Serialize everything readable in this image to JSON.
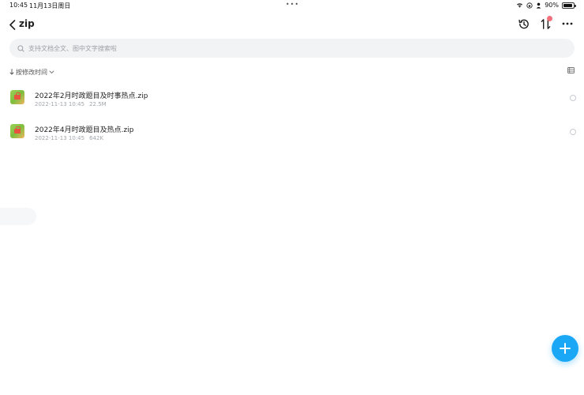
{
  "status_bar": {
    "time": "10:45",
    "date": "11月13日周日",
    "battery": "90%",
    "battery_level": 0.9
  },
  "nav": {
    "title": "zip"
  },
  "search": {
    "placeholder": "支持文档全文、图中文字搜索啦"
  },
  "sort": {
    "label": "按修改时间"
  },
  "files": [
    {
      "name": "2022年2月时政题目及时事热点.zip",
      "modified": "2022-11-13 10:45",
      "size": "22.5M"
    },
    {
      "name": "2022年4月时政题目及热点.zip",
      "modified": "2022-11-13 10:45",
      "size": "642K"
    }
  ],
  "colors": {
    "accent": "#1aa7f6",
    "badge": "#f1707b",
    "search_bg": "#f2f3f5"
  }
}
